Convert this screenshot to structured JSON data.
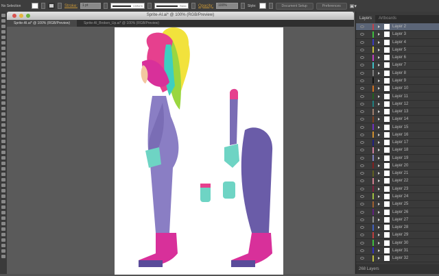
{
  "control_bar": {
    "selection_label": "No Selection",
    "stroke_label": "Stroke:",
    "stroke_weight": "1 pt",
    "profile": "Uniform",
    "brush": "Basic",
    "opacity_label": "Opacity:",
    "opacity": "100%",
    "style_label": "Style:",
    "document_setup": "Document Setup",
    "preferences": "Preferences"
  },
  "window": {
    "title": "Sprite-AI.ai* @ 100% (RGB/Preview)"
  },
  "tabs": [
    {
      "label": "Sprite-AI.ai* @ 100% (RGB/Preview)"
    },
    {
      "label": "Sprite-AI_Broken_Up.ai* @ 100% (RGB/Preview)"
    }
  ],
  "layers_panel": {
    "tabs": [
      "Layers",
      "Artboards"
    ],
    "footer": "268 Layers",
    "layers": [
      {
        "name": "Layer 2",
        "color": "#c0404a"
      },
      {
        "name": "Layer 3",
        "color": "#3fbf3f"
      },
      {
        "name": "Layer 4",
        "color": "#3a3ac0"
      },
      {
        "name": "Layer 5",
        "color": "#c8c040"
      },
      {
        "name": "Layer 6",
        "color": "#c040c0"
      },
      {
        "name": "Layer 7",
        "color": "#40c0c8"
      },
      {
        "name": "Layer 8",
        "color": "#808080"
      },
      {
        "name": "Layer 9",
        "color": "#111111"
      },
      {
        "name": "Layer 10",
        "color": "#d07020"
      },
      {
        "name": "Layer 11",
        "color": "#206020"
      },
      {
        "name": "Layer 12",
        "color": "#208080"
      },
      {
        "name": "Layer 13",
        "color": "#a08070"
      },
      {
        "name": "Layer 14",
        "color": "#804020"
      },
      {
        "name": "Layer 15",
        "color": "#7030c0"
      },
      {
        "name": "Layer 16",
        "color": "#d09030"
      },
      {
        "name": "Layer 17",
        "color": "#202080"
      },
      {
        "name": "Layer 18",
        "color": "#d080a0"
      },
      {
        "name": "Layer 19",
        "color": "#8080c0"
      },
      {
        "name": "Layer 20",
        "color": "#802020"
      },
      {
        "name": "Layer 21",
        "color": "#606020"
      },
      {
        "name": "Layer 22",
        "color": "#d08090"
      },
      {
        "name": "Layer 23",
        "color": "#802040"
      },
      {
        "name": "Layer 24",
        "color": "#a0c040"
      },
      {
        "name": "Layer 25",
        "color": "#a06030"
      },
      {
        "name": "Layer 26",
        "color": "#602080"
      },
      {
        "name": "Layer 27",
        "color": "#909090"
      },
      {
        "name": "Layer 28",
        "color": "#4060c0"
      },
      {
        "name": "Layer 29",
        "color": "#c04040"
      },
      {
        "name": "Layer 30",
        "color": "#40c040"
      },
      {
        "name": "Layer 31",
        "color": "#3030c0"
      },
      {
        "name": "Layer 32",
        "color": "#c0c040"
      }
    ]
  }
}
